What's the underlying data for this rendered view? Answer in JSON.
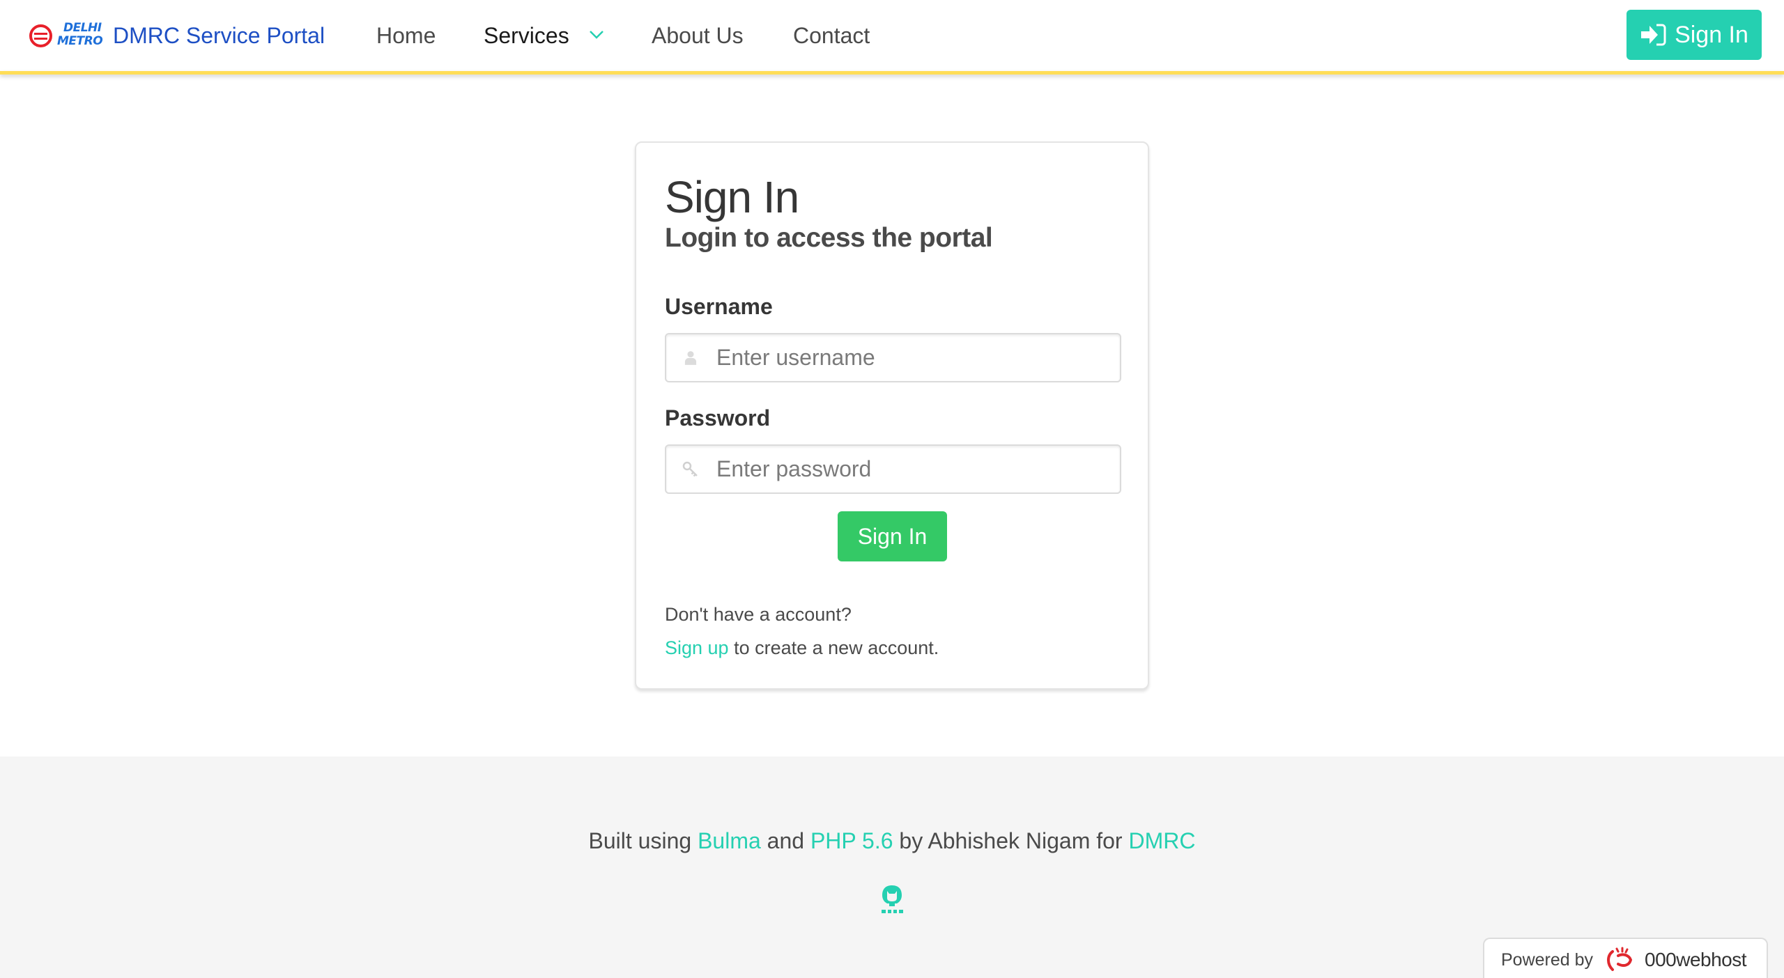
{
  "navbar": {
    "logo": {
      "line1": "DELHI",
      "line2": "METRO"
    },
    "brand": "DMRC Service Portal",
    "items": [
      {
        "label": "Home"
      },
      {
        "label": "Services",
        "has_dropdown": true
      },
      {
        "label": "About Us"
      },
      {
        "label": "Contact"
      }
    ],
    "signin_label": "Sign In",
    "colors": {
      "accent_strip": "#ffdd57",
      "primary": "#25d0b1",
      "brand": "#1d4fc4"
    }
  },
  "card": {
    "title": "Sign In",
    "subtitle": "Login to access the portal",
    "username": {
      "label": "Username",
      "placeholder": "Enter username",
      "value": "",
      "icon": "user-icon"
    },
    "password": {
      "label": "Password",
      "placeholder": "Enter password",
      "value": "",
      "icon": "key-icon"
    },
    "submit_label": "Sign In",
    "no_account_text": "Don't have a account?",
    "signup_link": "Sign up",
    "signup_suffix": " to create a new account.",
    "colors": {
      "submit": "#34c966"
    }
  },
  "footer": {
    "prefix": "Built using ",
    "link1": "Bulma",
    "mid1": " and ",
    "link2": "PHP 5.6",
    "mid2": " by Abhishek Nigam for ",
    "link3": "DMRC",
    "icon": "github-icon"
  },
  "badge": {
    "text": "Powered by",
    "brand": "000webhost"
  }
}
